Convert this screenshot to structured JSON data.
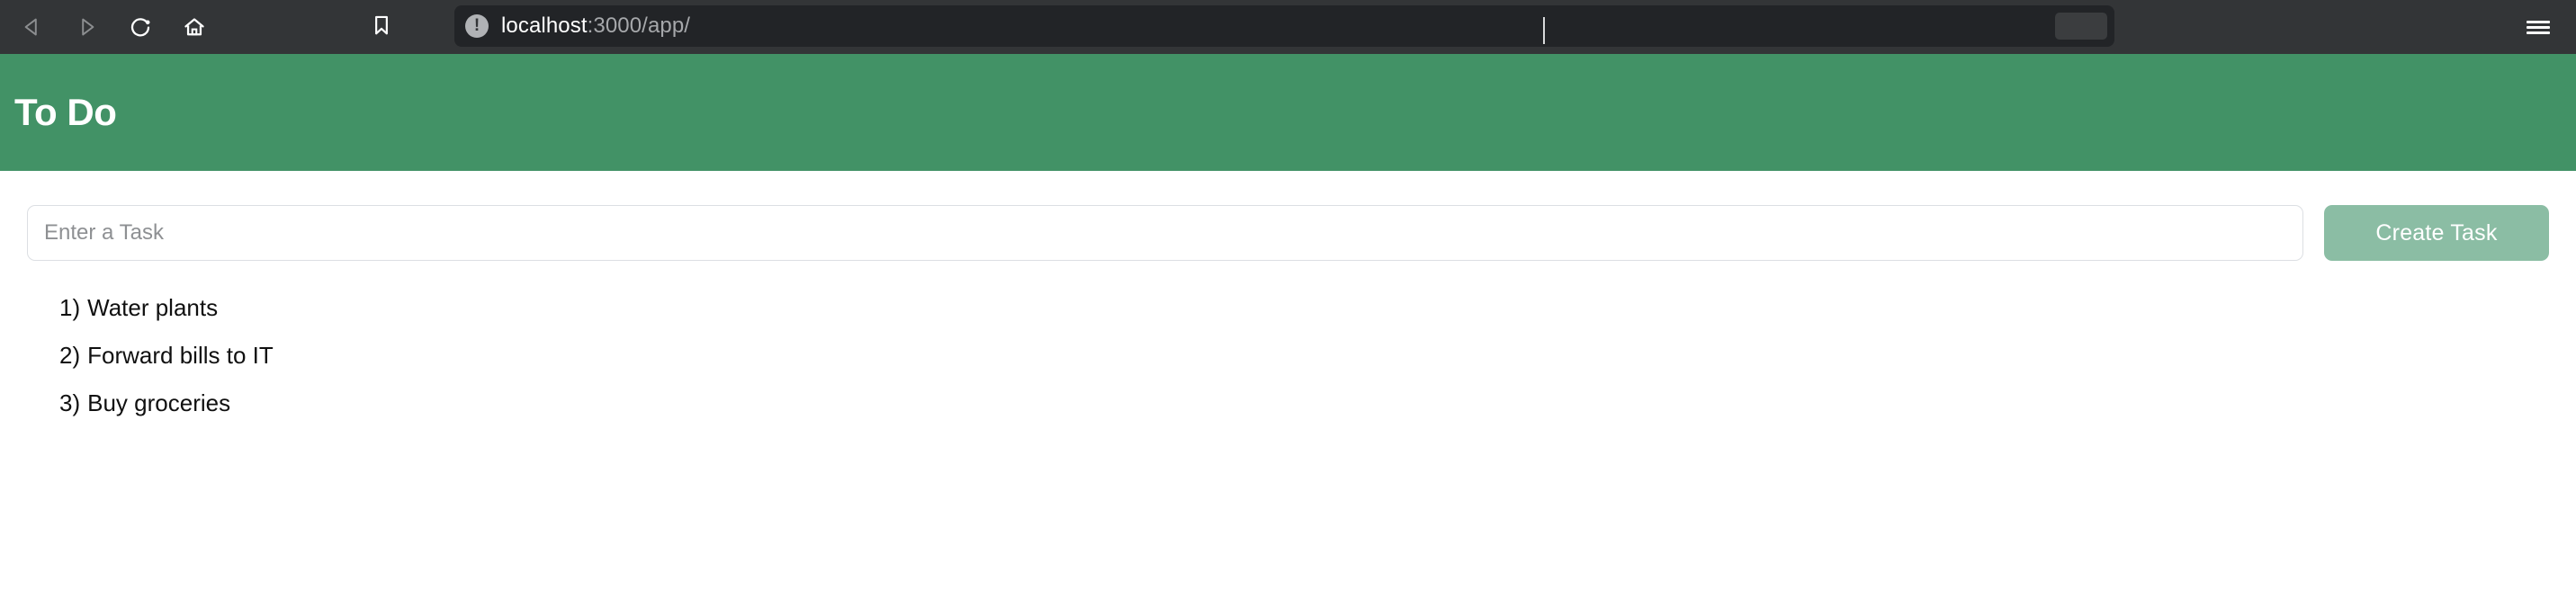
{
  "browser": {
    "nav": {
      "back_label": "Back",
      "forward_label": "Forward",
      "reload_label": "Reload",
      "home_label": "Home",
      "bookmark_label": "Bookmark",
      "menu_label": "Menu"
    },
    "url": {
      "host": "localhost",
      "path": ":3000/app/",
      "security_icon_glyph": "!",
      "security_icon_name": "not-secure-info-icon"
    },
    "colors": {
      "chrome_bg": "#333537",
      "urlbar_bg": "#222427"
    }
  },
  "app": {
    "title": "To Do",
    "header_color": "#429266",
    "form": {
      "input_placeholder": "Enter a Task",
      "input_value": "",
      "create_button_label": "Create Task",
      "create_button_color": "#8bbda4"
    },
    "tasks": [
      {
        "index": "1)",
        "text": "Water plants"
      },
      {
        "index": "2)",
        "text": "Forward bills to IT"
      },
      {
        "index": "3)",
        "text": "Buy groceries"
      }
    ]
  }
}
